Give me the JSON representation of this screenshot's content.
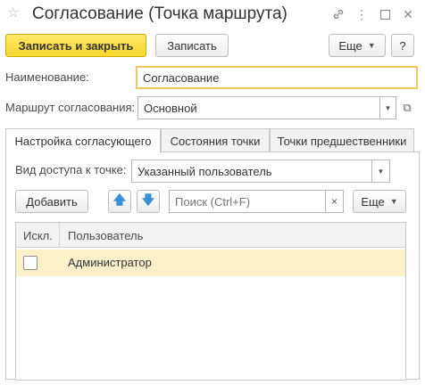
{
  "window": {
    "title": "Согласование (Точка маршрута)",
    "icons": [
      "star-icon",
      "link-icon",
      "more-icon",
      "maximize-icon",
      "close-icon"
    ]
  },
  "toolbar": {
    "save_close_label": "Записать и закрыть",
    "save_label": "Записать",
    "more_label": "Еще",
    "help_label": "?"
  },
  "form": {
    "name_label": "Наименование:",
    "name_value": "Согласование",
    "route_label": "Маршрут согласования:",
    "route_value": "Основной"
  },
  "tabs": [
    {
      "label": "Настройка согласующего",
      "active": true
    },
    {
      "label": "Состояния точки",
      "active": false
    },
    {
      "label": "Точки предшественники",
      "active": false
    }
  ],
  "panel": {
    "access_label": "Вид доступа к точке:",
    "access_value": "Указанный пользователь",
    "add_label": "Добавить",
    "search_placeholder": "Поиск (Ctrl+F)",
    "more_label": "Еще"
  },
  "table": {
    "columns": [
      "Искл.",
      "Пользователь"
    ],
    "rows": [
      {
        "excluded": false,
        "user": "Администратор"
      }
    ]
  },
  "colors": {
    "primary_button": "#f6d52c",
    "selected_row": "#fbf0c8",
    "focus_border": "#f0c85e",
    "arrow_blue": "#3a8fd8"
  }
}
